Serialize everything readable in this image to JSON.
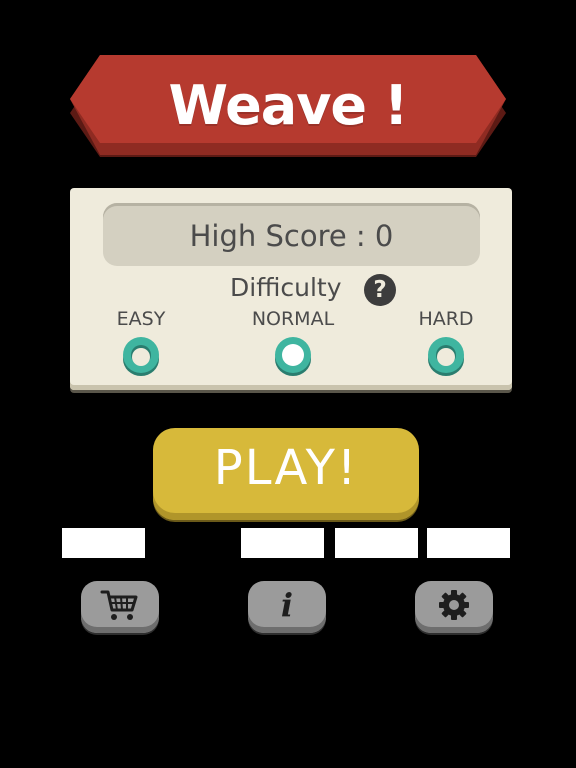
{
  "game": {
    "title": "Weave !",
    "high_score_text": "High Score : 0",
    "difficulty_label": "Difficulty",
    "help_glyph": "?",
    "difficulties": {
      "easy": "EASY",
      "normal": "NORMAL",
      "hard": "HARD"
    },
    "selected_difficulty": "NORMAL",
    "play_label": "PLAY!"
  },
  "toolbar": {
    "icons": [
      "shopping-cart-icon",
      "info-icon",
      "gear-icon"
    ],
    "info_glyph": "i"
  },
  "colors": {
    "background": "#000000",
    "title_banner": "#b63a2f",
    "panel": "#efebdc",
    "score_box": "#d4d0c1",
    "play_button": "#d7b93a",
    "radio_ring": "#3fb5a0",
    "icon_button": "#9b9b9b"
  }
}
